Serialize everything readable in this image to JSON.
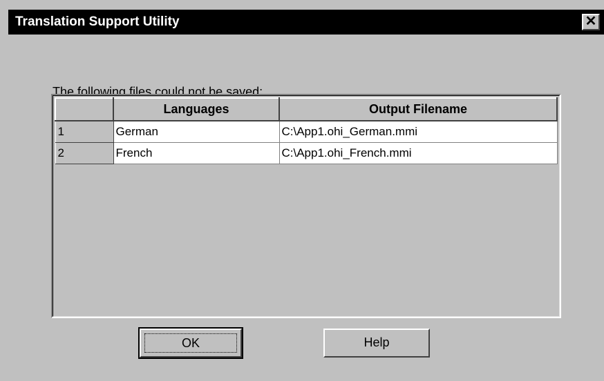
{
  "window": {
    "title": "Translation Support Utility",
    "close_glyph": "✕"
  },
  "message": "The following files could not be saved:",
  "table": {
    "columns": [
      "",
      "Languages",
      "Output Filename"
    ],
    "rows": [
      {
        "index": "1",
        "language": "German",
        "filename": "C:\\App1.ohi_German.mmi"
      },
      {
        "index": "2",
        "language": "French",
        "filename": "C:\\App1.ohi_French.mmi"
      }
    ]
  },
  "buttons": {
    "ok_label": "OK",
    "help_label": "Help"
  },
  "colors": {
    "face": "#c0c0c0",
    "titlebar": "#000000",
    "cell": "#ffffff"
  }
}
